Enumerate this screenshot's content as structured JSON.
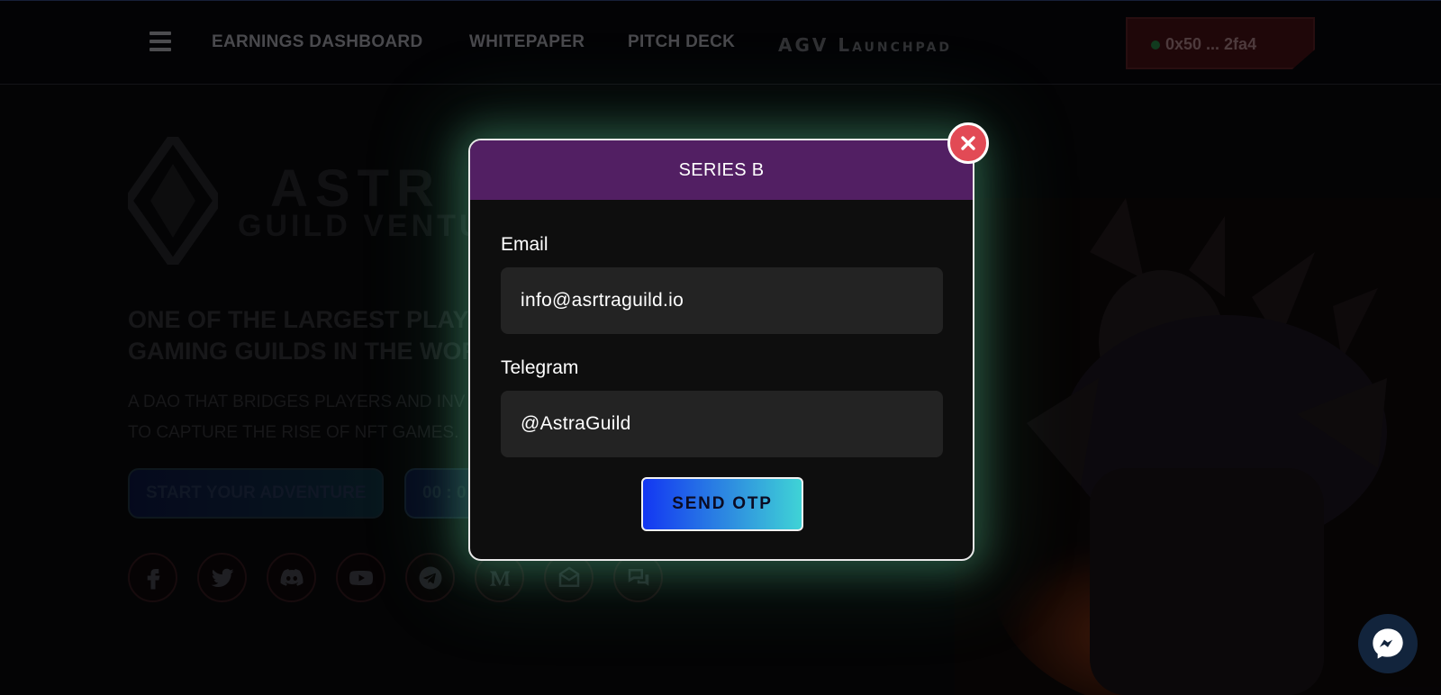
{
  "navbar": {
    "links": [
      "EARNINGS DASHBOARD",
      "WHITEPAPER",
      "PITCH DECK"
    ],
    "launchpad_label": "AGV Launchpad",
    "wallet_address": "0x50 ... 2fa4"
  },
  "hero": {
    "logo_title": "ASTR",
    "logo_subtitle": "GUILD VENTU",
    "headline_line1": "ONE OF THE LARGEST PLAY-T",
    "headline_line2": "GAMING GUILDS IN THE WOR",
    "subline_line1": "A DAO THAT BRIDGES PLAYERS AND INV",
    "subline_line2": "TO CAPTURE THE RISE OF NFT GAMES.",
    "adventure_button": "START YOUR ADVENTURE",
    "timer_button": "00 : 0"
  },
  "socials": [
    {
      "icon": "facebook-icon"
    },
    {
      "icon": "twitter-icon"
    },
    {
      "icon": "discord-icon"
    },
    {
      "icon": "youtube-icon"
    },
    {
      "icon": "telegram-icon"
    },
    {
      "icon": "medium-icon"
    },
    {
      "icon": "mail-icon"
    },
    {
      "icon": "chat-icon"
    }
  ],
  "modal": {
    "title": "SERIES B",
    "email_label": "Email",
    "email_value": "info@asrtraguild.io",
    "telegram_label": "Telegram",
    "telegram_value": "@AstraGuild",
    "submit_label": "SEND OTP"
  },
  "colors": {
    "modal_header": "#521f63",
    "close_button": "#e24a55",
    "otp_gradient_start": "#1337f2",
    "otp_gradient_end": "#3fd3d6",
    "modal_glow": "#5ac896"
  }
}
